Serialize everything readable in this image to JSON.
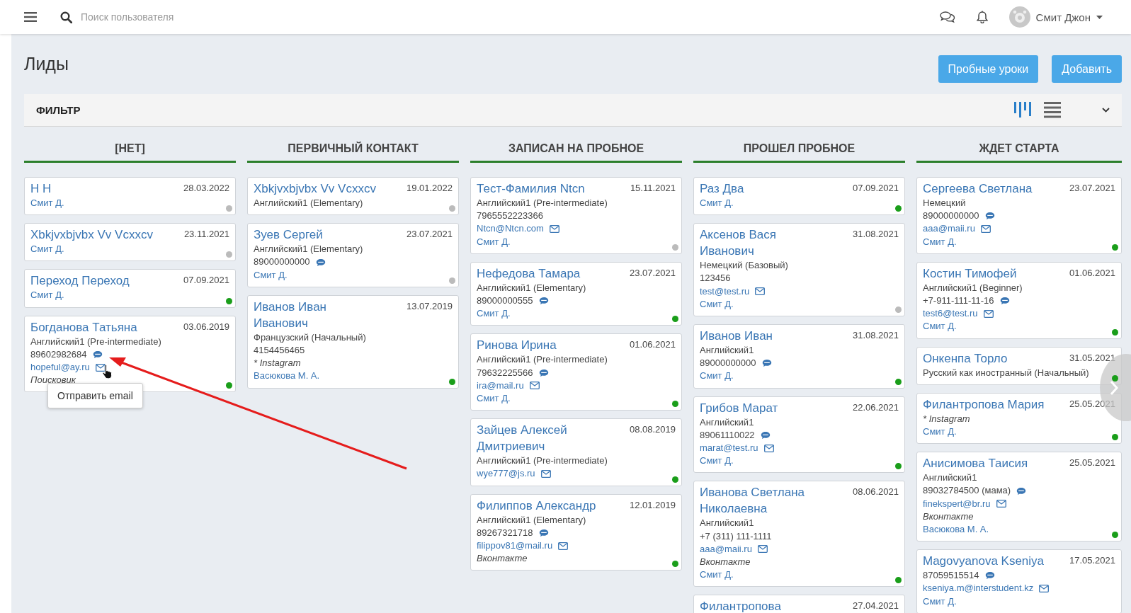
{
  "header": {
    "search": {
      "placeholder": "Поиск пользователя"
    },
    "user": {
      "name": "Смит Джон"
    }
  },
  "page": {
    "title": "Лиды",
    "buttons": [
      "Пробные уроки",
      "Добавить"
    ]
  },
  "filter": {
    "label": "ФИЛЬТР",
    "views": [
      {
        "kind": "board",
        "selected": true
      },
      {
        "kind": "list",
        "selected": false
      }
    ]
  },
  "columns": [
    {
      "title": "[НЕТ]",
      "cards": [
        {
          "name": "Н Н",
          "date": "28.03.2022",
          "lines": [
            {
              "kind": "manager",
              "text": "Смит Д."
            }
          ],
          "color": "#bbbbbb"
        },
        {
          "name": "Xbkjvxbjvbx Vv Vcxxcv",
          "date": "23.11.2021",
          "lines": [
            {
              "kind": "manager",
              "text": "Смит Д."
            }
          ],
          "color": "#bbbbbb"
        },
        {
          "name": "Переход Переход",
          "date": "07.09.2021",
          "lines": [
            {
              "kind": "manager",
              "text": "Смит Д."
            }
          ],
          "color": "#1a9e1a"
        },
        {
          "name": "Богданова Татьяна",
          "date": "03.06.2019",
          "lines": [
            {
              "kind": "text",
              "text": "Английский1 (Pre-intermediate)"
            },
            {
              "kind": "phone",
              "text": "89602982684"
            },
            {
              "kind": "email",
              "text": "hopeful@ay.ru"
            },
            {
              "kind": "source",
              "text": "Поисковик"
            }
          ],
          "color": "#1a9e1a"
        }
      ]
    },
    {
      "title": "ПЕРВИЧНЫЙ КОНТАКТ",
      "cards": [
        {
          "name": "Xbkjvxbjvbx Vv Vcxxcv",
          "date": "19.01.2022",
          "lines": [
            {
              "kind": "text",
              "text": "Английский1 (Elementary)"
            }
          ],
          "color": "#bbbbbb"
        },
        {
          "name": "Зуев Сергей",
          "date": "23.07.2021",
          "lines": [
            {
              "kind": "text",
              "text": "Английский1 (Elementary)"
            },
            {
              "kind": "phone",
              "text": "89000000000"
            },
            {
              "kind": "manager",
              "text": "Смит Д."
            }
          ],
          "color": "#bbbbbb"
        },
        {
          "name": "Иванов Иван Иванович",
          "date": "13.07.2019",
          "lines": [
            {
              "kind": "text",
              "text": "Французский (Начальный)"
            },
            {
              "kind": "text",
              "text": "4154456465"
            },
            {
              "kind": "source",
              "text": "* Instagram"
            },
            {
              "kind": "manager",
              "text": "Васюкова М. А."
            }
          ],
          "color": "#1a9e1a"
        }
      ]
    },
    {
      "title": "ЗАПИСАН НА ПРОБНОЕ",
      "cards": [
        {
          "name": "Тест-Фамилия Ntcn",
          "date": "15.11.2021",
          "lines": [
            {
              "kind": "text",
              "text": "Английский1 (Pre-intermediate)"
            },
            {
              "kind": "text",
              "text": "7965552223366"
            },
            {
              "kind": "email",
              "text": "Ntcn@Ntcn.com"
            },
            {
              "kind": "manager",
              "text": "Смит Д."
            }
          ],
          "color": "#bbbbbb"
        },
        {
          "name": "Нефедова Тамара",
          "date": "23.07.2021",
          "lines": [
            {
              "kind": "text",
              "text": "Английский1 (Elementary)"
            },
            {
              "kind": "phone",
              "text": "89000000555"
            },
            {
              "kind": "manager",
              "text": "Смит Д."
            }
          ],
          "color": "#1a9e1a"
        },
        {
          "name": "Ринова Ирина",
          "date": "01.06.2021",
          "lines": [
            {
              "kind": "text",
              "text": "Английский1 (Pre-intermediate)"
            },
            {
              "kind": "phone",
              "text": "79632225566"
            },
            {
              "kind": "email",
              "text": "ira@mail.ru"
            },
            {
              "kind": "manager",
              "text": "Смит Д."
            }
          ],
          "color": "#1a9e1a"
        },
        {
          "name": "Зайцев Алексей Дмитриевич",
          "date": "08.08.2019",
          "lines": [
            {
              "kind": "text",
              "text": "Английский1 (Pre-intermediate)"
            },
            {
              "kind": "email",
              "text": "wye777@js.ru"
            }
          ],
          "color": "#1a9e1a"
        },
        {
          "name": "Филиппов Александр",
          "date": "12.01.2019",
          "lines": [
            {
              "kind": "text",
              "text": "Английский1 (Elementary)"
            },
            {
              "kind": "phone",
              "text": "89267321718"
            },
            {
              "kind": "email",
              "text": "filippov81@mail.ru"
            },
            {
              "kind": "source",
              "text": "Вконтакте"
            }
          ],
          "color": "#1a9e1a"
        }
      ]
    },
    {
      "title": "ПРОШЕЛ ПРОБНОЕ",
      "cards": [
        {
          "name": "Раз Два",
          "date": "07.09.2021",
          "lines": [
            {
              "kind": "manager",
              "text": "Смит Д."
            }
          ],
          "color": "#1a9e1a"
        },
        {
          "name": "Аксенов Вася Иванович",
          "date": "31.08.2021",
          "lines": [
            {
              "kind": "text",
              "text": "Немецкий (Базовый)"
            },
            {
              "kind": "text",
              "text": "123456"
            },
            {
              "kind": "email",
              "text": "test@test.ru"
            },
            {
              "kind": "manager",
              "text": "Смит Д."
            }
          ],
          "color": "#bbbbbb"
        },
        {
          "name": "Иванов Иван",
          "date": "31.08.2021",
          "lines": [
            {
              "kind": "text",
              "text": "Английский1"
            },
            {
              "kind": "phone",
              "text": "89000000000"
            },
            {
              "kind": "manager",
              "text": "Смит Д."
            }
          ],
          "color": "#1a9e1a"
        },
        {
          "name": "Грибов Марат",
          "date": "22.06.2021",
          "lines": [
            {
              "kind": "text",
              "text": "Английский1"
            },
            {
              "kind": "phone",
              "text": "89061110022"
            },
            {
              "kind": "email",
              "text": "marat@test.ru"
            },
            {
              "kind": "manager",
              "text": "Смит Д."
            }
          ],
          "color": "#1a9e1a"
        },
        {
          "name": "Иванова Светлана Николаевна",
          "date": "08.06.2021",
          "lines": [
            {
              "kind": "text",
              "text": "Английский1"
            },
            {
              "kind": "text",
              "text": "+7 (311) 111-1111"
            },
            {
              "kind": "email",
              "text": "aaa@maii.ru"
            },
            {
              "kind": "source",
              "text": "Вконтакте"
            },
            {
              "kind": "manager",
              "text": "Смит Д."
            }
          ],
          "color": "#1a9e1a"
        },
        {
          "name": "Филантропова",
          "date": "27.04.2021"
        }
      ]
    },
    {
      "title": "ЖДЕТ СТАРТА",
      "cards": [
        {
          "name": "Сергеева Светлана",
          "date": "23.07.2021",
          "lines": [
            {
              "kind": "text",
              "text": "Немецкий"
            },
            {
              "kind": "phone",
              "text": "89000000000"
            },
            {
              "kind": "email",
              "text": "aaa@maii.ru"
            },
            {
              "kind": "manager",
              "text": "Смит Д."
            }
          ],
          "color": "#1a9e1a"
        },
        {
          "name": "Костин Тимофей",
          "date": "01.06.2021",
          "lines": [
            {
              "kind": "text",
              "text": "Английский1 (Beginner)"
            },
            {
              "kind": "phone",
              "text": "+7-911-111-11-16"
            },
            {
              "kind": "email",
              "text": "test6@test.ru"
            },
            {
              "kind": "manager",
              "text": "Смит Д."
            }
          ],
          "color": "#1a9e1a"
        },
        {
          "name": "Онкенпа Торло",
          "date": "31.05.2021",
          "lines": [
            {
              "kind": "text",
              "text": "Русский как иностранный (Начальный)"
            }
          ],
          "color": "#1a9e1a"
        },
        {
          "name": "Филантропова Мария",
          "date": "25.05.2021",
          "lines": [
            {
              "kind": "source",
              "text": "* Instagram"
            },
            {
              "kind": "manager",
              "text": "Смит Д."
            }
          ],
          "color": "#1a9e1a"
        },
        {
          "name": "Анисимова Таисия",
          "date": "25.05.2021",
          "lines": [
            {
              "kind": "text",
              "text": "Английский1"
            },
            {
              "kind": "phone",
              "text": "89032784500 (мама)"
            },
            {
              "kind": "email",
              "text": "finekspert@br.ru"
            },
            {
              "kind": "source",
              "text": "Вконтакте"
            },
            {
              "kind": "manager",
              "text": "Васюкова М. А."
            }
          ],
          "color": "#1a9e1a"
        },
        {
          "name": "Magovyanova Kseniya",
          "date": "17.05.2021",
          "lines": [
            {
              "kind": "phone",
              "text": "87059515514"
            },
            {
              "kind": "email",
              "text": "kseniya.m@interstudent.kz"
            },
            {
              "kind": "manager",
              "text": "Смит Д."
            }
          ]
        }
      ]
    }
  ],
  "tooltip": {
    "text": "Отправить email"
  }
}
